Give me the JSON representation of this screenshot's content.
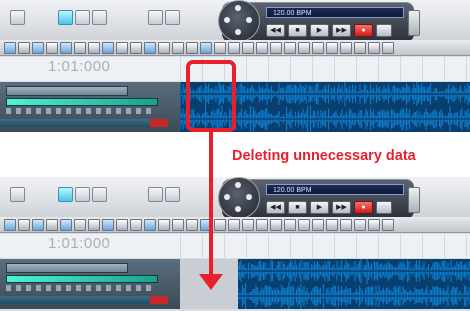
{
  "transport": {
    "tempo": "120.00 BPM"
  },
  "ruler": {
    "time": "1:01:000"
  },
  "annotation": {
    "caption": "Deleting unnecessary data"
  },
  "colors": {
    "highlight": "#e8202c",
    "waveform": "#0d79c7"
  },
  "icons": [
    "transport-dial-icon",
    "play-icon",
    "stop-icon",
    "rewind-icon",
    "record-icon"
  ]
}
